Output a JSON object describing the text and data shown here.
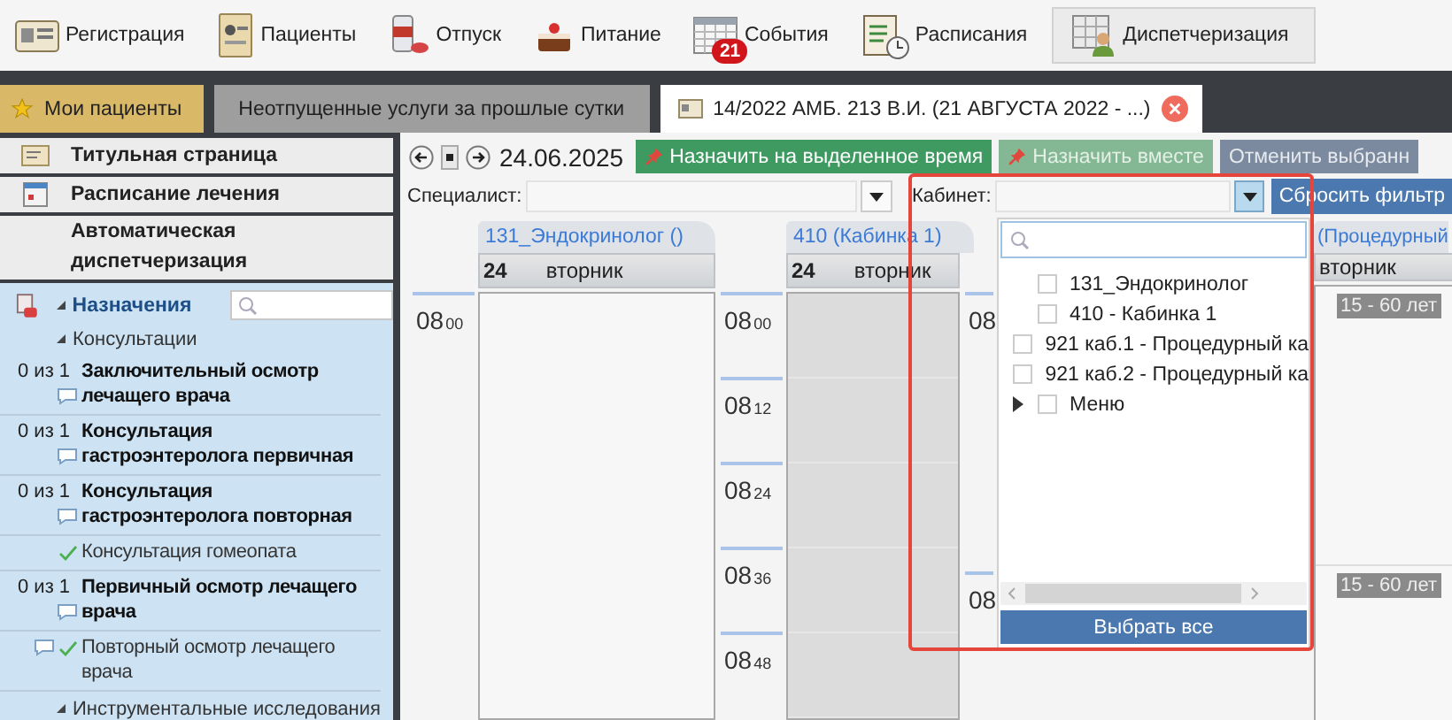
{
  "toolbar": [
    {
      "label": "Регистрация",
      "selected": false
    },
    {
      "label": "Пациенты",
      "selected": false
    },
    {
      "label": "Отпуск",
      "selected": false
    },
    {
      "label": "Питание",
      "selected": false
    },
    {
      "label": "События",
      "selected": false,
      "badge": "21"
    },
    {
      "label": "Расписания",
      "selected": false
    },
    {
      "label": "Диспетчеризация",
      "selected": true
    }
  ],
  "tabs": [
    {
      "label": "Мои пациенты",
      "kind": "favorite",
      "selected": false
    },
    {
      "label": "Неотпущенные услуги за прошлые сутки",
      "kind": "plain",
      "selected": false
    },
    {
      "label": "14/2022 АМБ. 213 В.И. (21 АВГУСТА 2022 - ...)",
      "kind": "document",
      "selected": true
    }
  ],
  "sidebar": {
    "sections": [
      {
        "label": "Титульная страница",
        "kind": "title"
      },
      {
        "label": "Расписание лечения",
        "kind": "schedule"
      },
      {
        "label": "Автоматическая диспетчеризация",
        "kind": "plain"
      }
    ],
    "tree": {
      "label": "Назначения",
      "expanded": true,
      "children": [
        {
          "label": "Консультации",
          "expanded": true,
          "children": [
            {
              "count": "0 из 1",
              "label": "Заключительный осмотр лечащего врача",
              "done": false,
              "comment": true
            },
            {
              "count": "0 из 1",
              "label": "Консультация гастроэнтеролога первичная",
              "done": false,
              "comment": true
            },
            {
              "count": "0 из 1",
              "label": "Консультация гастроэнтеролога повторная",
              "done": false,
              "comment": true
            },
            {
              "label": "Консультация гомеопата",
              "done": true,
              "comment": false
            },
            {
              "count": "0 из 1",
              "label": "Первичный осмотр лечащего врача",
              "done": false,
              "comment": true
            },
            {
              "label": "Повторный осмотр лечащего врача",
              "done": true,
              "comment": true
            }
          ]
        },
        {
          "label": "Инструментальные исследования",
          "expanded": true
        }
      ]
    }
  },
  "scheduler": {
    "date": "24.06.2025",
    "actions": [
      {
        "label": "Назначить на выделенное время",
        "kind": "assign",
        "disabled": false
      },
      {
        "label": "Назначить вместе",
        "kind": "assign",
        "disabled": true
      },
      {
        "label": "Отменить выбранн",
        "kind": "cancel",
        "disabled": true
      }
    ],
    "filters": {
      "specialist_label": "Специалист:",
      "cabinet_label": "Кабинет:",
      "reset": "Сбросить фильтр"
    },
    "columns": [
      {
        "title": "131_Эндокринолог ()",
        "day_number": "24",
        "day_name": "вторник",
        "shaded": false,
        "times": [
          {
            "hour": "08",
            "minute": "00"
          }
        ]
      },
      {
        "title": "410 (Кабинка 1)",
        "day_number": "24",
        "day_name": "вторник",
        "shaded": true,
        "times": [
          {
            "hour": "08",
            "minute": "00"
          },
          {
            "hour": "08",
            "minute": "12"
          },
          {
            "hour": "08",
            "minute": "24"
          },
          {
            "hour": "08",
            "minute": "36"
          },
          {
            "hour": "08",
            "minute": "48"
          }
        ]
      },
      {
        "title": "(Процедурный",
        "day_name": "вторник",
        "shaded": false,
        "times": [
          {
            "hour": "08"
          },
          {
            "hour": "08"
          }
        ],
        "badges": [
          "15 - 60 лет",
          "15 - 60 лет"
        ]
      }
    ]
  },
  "cabinet_popup": {
    "items": [
      {
        "label": "131_Эндокринолог",
        "checked": false,
        "expandable": false
      },
      {
        "label": "410 - Кабинка 1",
        "checked": false,
        "expandable": false
      },
      {
        "label": "921 каб.1 - Процедурный ка",
        "checked": false,
        "expandable": false
      },
      {
        "label": "921 каб.2 - Процедурный ка",
        "checked": false,
        "expandable": false
      },
      {
        "label": "Меню",
        "checked": false,
        "expandable": true
      }
    ],
    "select_all": "Выбрать все"
  }
}
